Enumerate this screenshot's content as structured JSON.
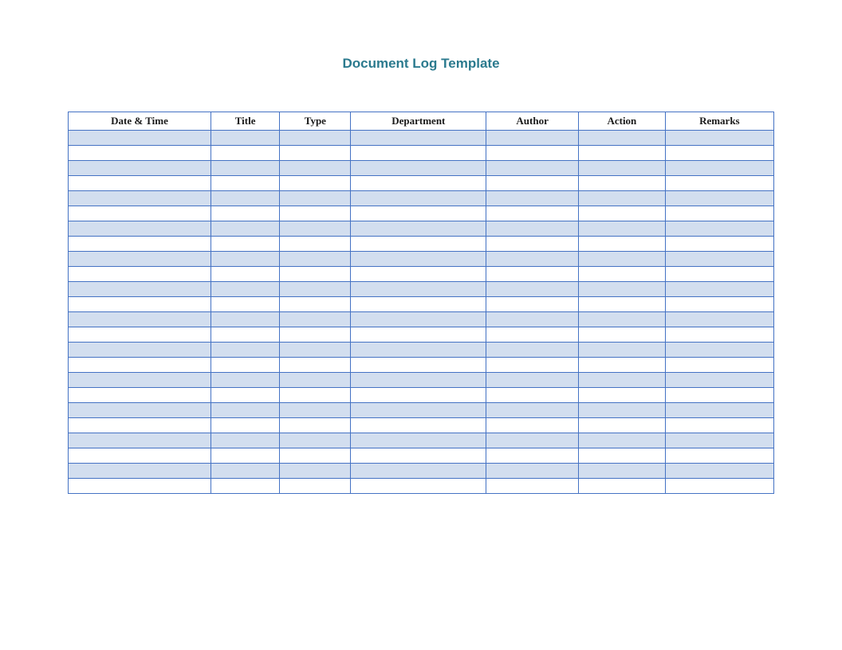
{
  "title": "Document Log Template",
  "table": {
    "columns": [
      "Date & Time",
      "Title",
      "Type",
      "Department",
      "Author",
      "Action",
      "Remarks"
    ],
    "rowCount": 24
  }
}
